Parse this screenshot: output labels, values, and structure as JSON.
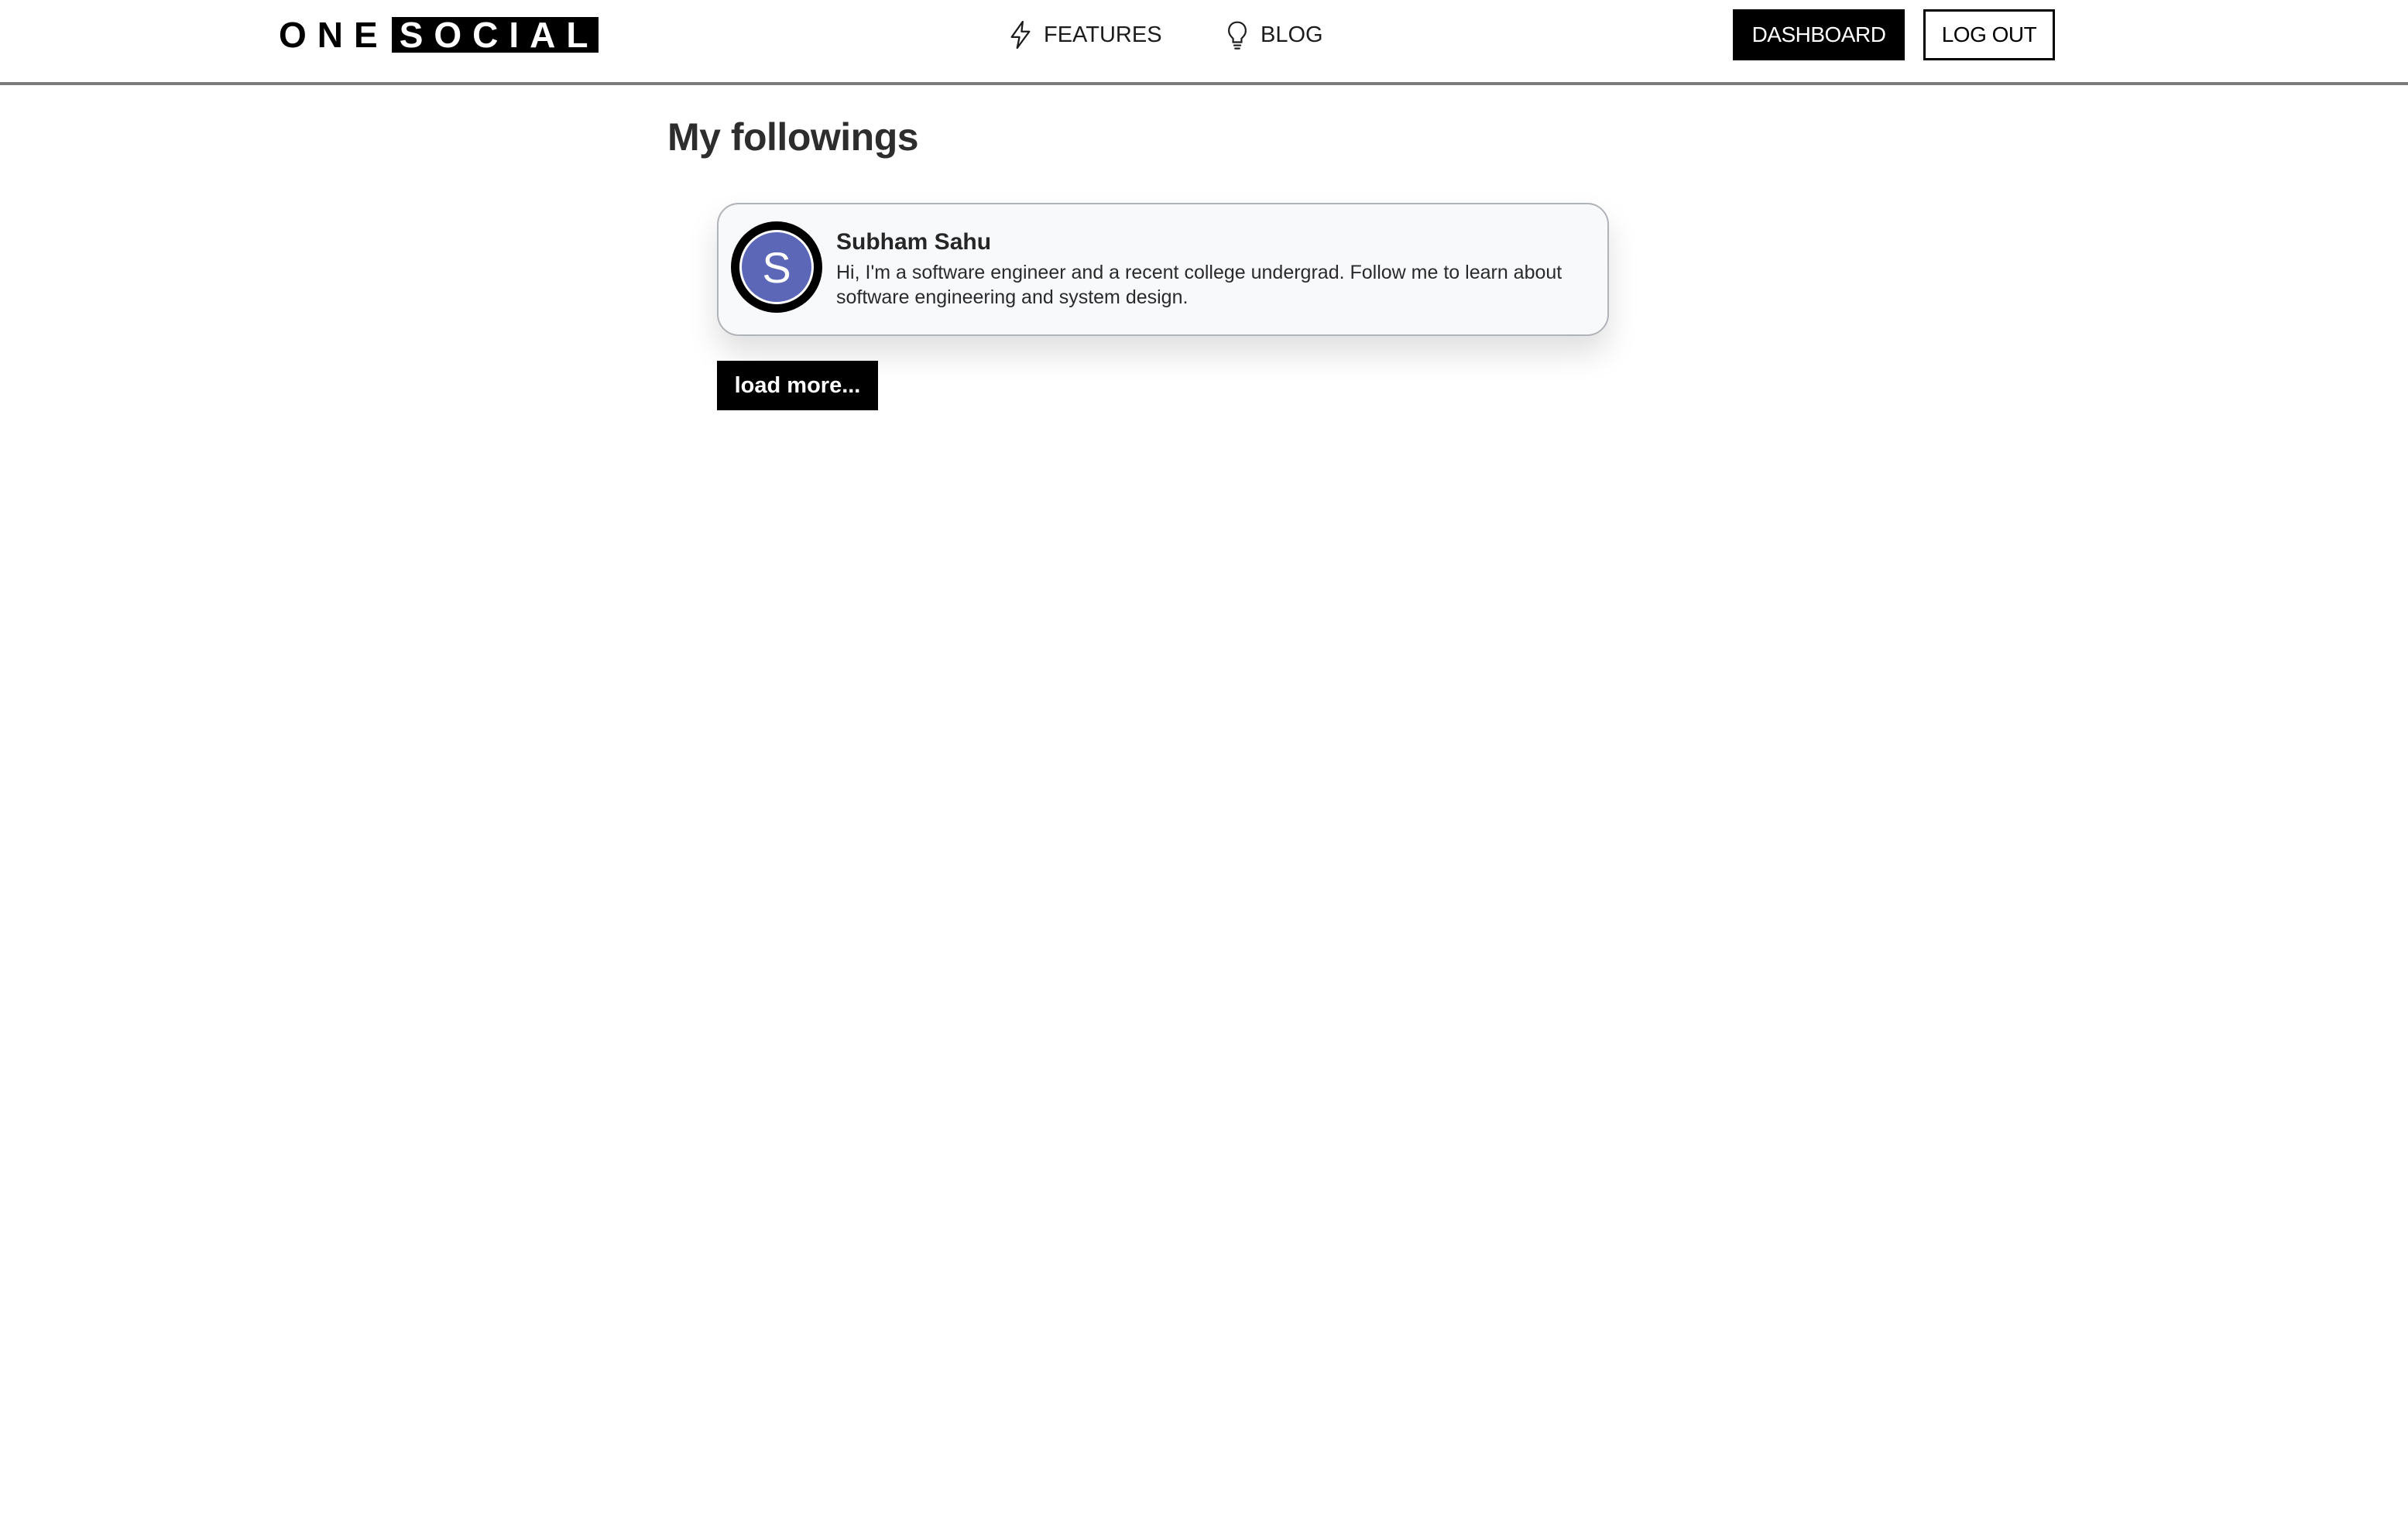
{
  "header": {
    "logo": {
      "part1": "ONE",
      "part2": "SOCIAL"
    },
    "nav": [
      {
        "label": "FEATURES",
        "icon": "lightning-icon"
      },
      {
        "label": "BLOG",
        "icon": "lightbulb-icon"
      }
    ],
    "dashboard_label": "DASHBOARD",
    "logout_label": "LOG OUT"
  },
  "main": {
    "title": "My followings",
    "followings": [
      {
        "avatar_letter": "S",
        "avatar_color": "#5c67b8",
        "name": "Subham Sahu",
        "bio": "Hi, I'm a software engineer and a recent college undergrad. Follow me to learn about software engineering and system design."
      }
    ],
    "load_more_label": "load more..."
  }
}
